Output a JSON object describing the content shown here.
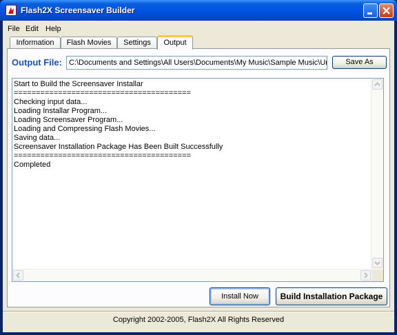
{
  "window": {
    "title": "Flash2X Screensaver Builder",
    "icons": {
      "app": "flash-app-icon",
      "minimize": "minimize-icon",
      "close": "close-icon"
    }
  },
  "menu": [
    {
      "label": "File"
    },
    {
      "label": "Edit"
    },
    {
      "label": "Help"
    }
  ],
  "tabs": [
    {
      "label": "Information",
      "active": false
    },
    {
      "label": "Flash Movies",
      "active": false
    },
    {
      "label": "Settings",
      "active": false
    },
    {
      "label": "Output",
      "active": true
    }
  ],
  "output": {
    "label": "Output File:",
    "file_path": "C:\\Documents and Settings\\All Users\\Documents\\My Music\\Sample Music\\Ur",
    "save_as_label": "Save As"
  },
  "log": {
    "lines": [
      "Start to Build the Screensaver Installar",
      "========================================",
      "Checking input data...",
      "Loading Installar Program...",
      "Loading Screensaver Program...",
      "Loading and Compressing Flash Movies...",
      "Saving data...",
      "Screensaver Installation Package Has Been Built Successfully",
      "========================================",
      "Completed"
    ]
  },
  "buttons": {
    "install_now": "Install Now",
    "build_package": "Build Installation Package"
  },
  "footer": {
    "copyright": "Copyright 2002-2005, Flash2X All Rights Reserved"
  },
  "colors": {
    "title_bar": "#0054e3",
    "output_label": "#1f4fb5",
    "active_tab_accent": "#ffc83c",
    "dialog_background": "#ece9d8"
  }
}
